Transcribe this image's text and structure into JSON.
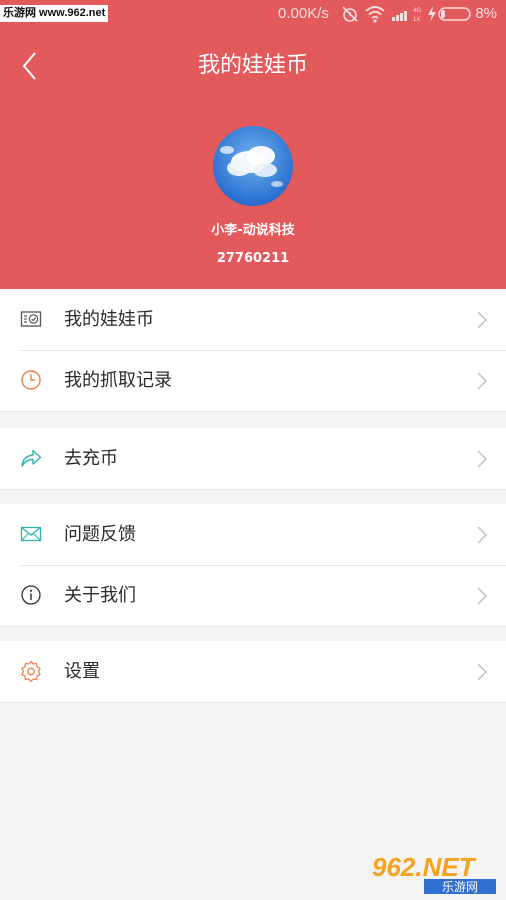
{
  "status_bar": {
    "watermark": "乐游网 www.962.net",
    "net_speed": "0.00K/s",
    "battery_percent": "8%",
    "icons": [
      "alarm-off-icon",
      "wifi-icon",
      "signal-icon",
      "charging-icon",
      "battery-icon"
    ]
  },
  "header": {
    "title": "我的娃娃币",
    "back_icon": "back-chevron-icon",
    "username": "小李-动说科技",
    "user_id": "27760211",
    "color": "#e35a5c"
  },
  "menu": {
    "group1": [
      {
        "label": "我的娃娃币",
        "icon": "coin-wallet-icon"
      },
      {
        "label": "我的抓取记录",
        "icon": "clock-icon"
      }
    ],
    "group2": [
      {
        "label": "去充币",
        "icon": "share-arrow-icon"
      }
    ],
    "group3": [
      {
        "label": "问题反馈",
        "icon": "mail-icon"
      },
      {
        "label": "关于我们",
        "icon": "info-icon"
      }
    ],
    "group4": [
      {
        "label": "设置",
        "icon": "gear-icon"
      }
    ]
  },
  "watermark_br": {
    "logo_text": "962.NET",
    "sub_text": "乐游网"
  }
}
